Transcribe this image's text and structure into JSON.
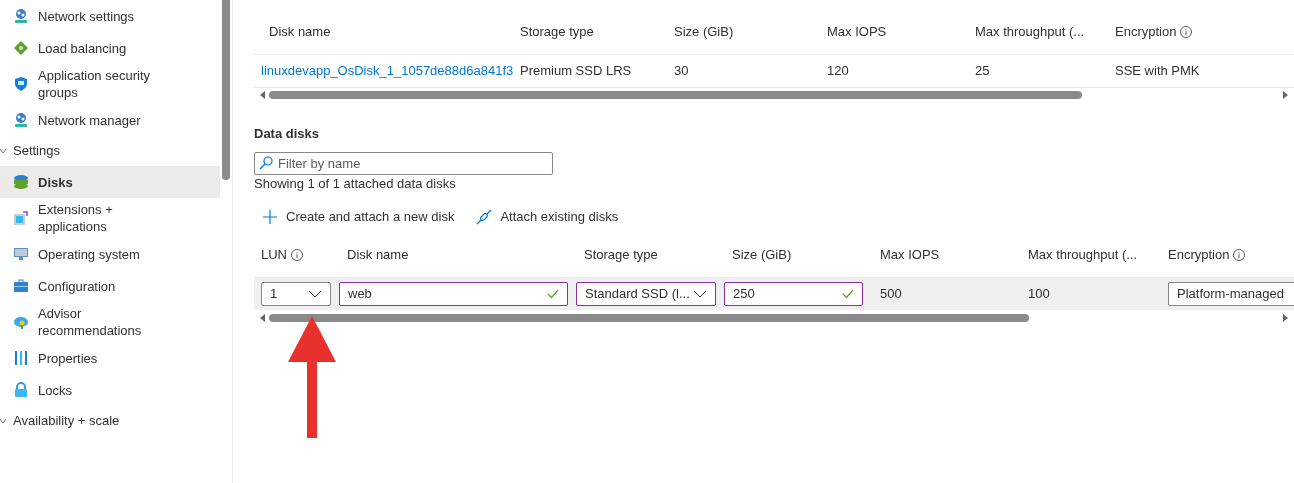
{
  "sidebar": {
    "items": [
      {
        "kind": "item",
        "label": "Network settings",
        "selected": false
      },
      {
        "kind": "item",
        "label": "Load balancing",
        "selected": false
      },
      {
        "kind": "item",
        "label": "Application security groups",
        "selected": false
      },
      {
        "kind": "item",
        "label": "Network manager",
        "selected": false
      },
      {
        "kind": "group",
        "label": "Settings",
        "expanded": true
      },
      {
        "kind": "item",
        "label": "Disks",
        "selected": true
      },
      {
        "kind": "item",
        "label": "Extensions + applications",
        "selected": false
      },
      {
        "kind": "item",
        "label": "Operating system",
        "selected": false
      },
      {
        "kind": "item",
        "label": "Configuration",
        "selected": false
      },
      {
        "kind": "item",
        "label": "Advisor recommendations",
        "selected": false
      },
      {
        "kind": "item",
        "label": "Properties",
        "selected": false
      },
      {
        "kind": "item",
        "label": "Locks",
        "selected": false
      },
      {
        "kind": "group",
        "label": "Availability + scale",
        "expanded": true
      }
    ]
  },
  "os_disk_table": {
    "columns": [
      {
        "label": "Disk name",
        "info": false
      },
      {
        "label": "Storage type",
        "info": false
      },
      {
        "label": "Size (GiB)",
        "info": false
      },
      {
        "label": "Max IOPS",
        "info": false
      },
      {
        "label": "Max throughput (...",
        "info": false
      },
      {
        "label": "Encryption",
        "info": true
      }
    ],
    "rows": [
      [
        {
          "kind": "link",
          "value": "linuxdevapp_OsDisk_1_1057de88d6a841f3"
        },
        {
          "kind": "text",
          "value": "Premium SSD LRS"
        },
        {
          "kind": "text",
          "value": "30"
        },
        {
          "kind": "text",
          "value": "120"
        },
        {
          "kind": "text",
          "value": "25"
        },
        {
          "kind": "text",
          "value": "SSE with PMK"
        }
      ]
    ]
  },
  "data_disks": {
    "title": "Data disks",
    "filter": {
      "placeholder": "Filter by name"
    },
    "summary": "Showing 1 of 1 attached data disks",
    "toolbar": [
      {
        "kind": "add",
        "label": "Create and attach a new disk"
      },
      {
        "kind": "attach",
        "label": "Attach existing disks"
      }
    ],
    "columns": [
      {
        "label": "LUN",
        "info": true
      },
      {
        "label": "Disk name",
        "info": false
      },
      {
        "label": "Storage type",
        "info": false
      },
      {
        "label": "Size (GiB)",
        "info": false
      },
      {
        "label": "Max IOPS",
        "info": false
      },
      {
        "label": "Max throughput (...",
        "info": false
      },
      {
        "label": "Encryption",
        "info": true
      }
    ],
    "rows": [
      [
        {
          "kind": "select",
          "value": "1",
          "valid": false
        },
        {
          "kind": "input",
          "value": "web",
          "valid": true
        },
        {
          "kind": "select",
          "value": "Standard SSD (l...",
          "valid": false
        },
        {
          "kind": "input",
          "value": "250",
          "valid": true
        },
        {
          "kind": "text",
          "value": "500"
        },
        {
          "kind": "text",
          "value": "100"
        },
        {
          "kind": "readonly",
          "value": "Platform-managed"
        }
      ]
    ]
  }
}
